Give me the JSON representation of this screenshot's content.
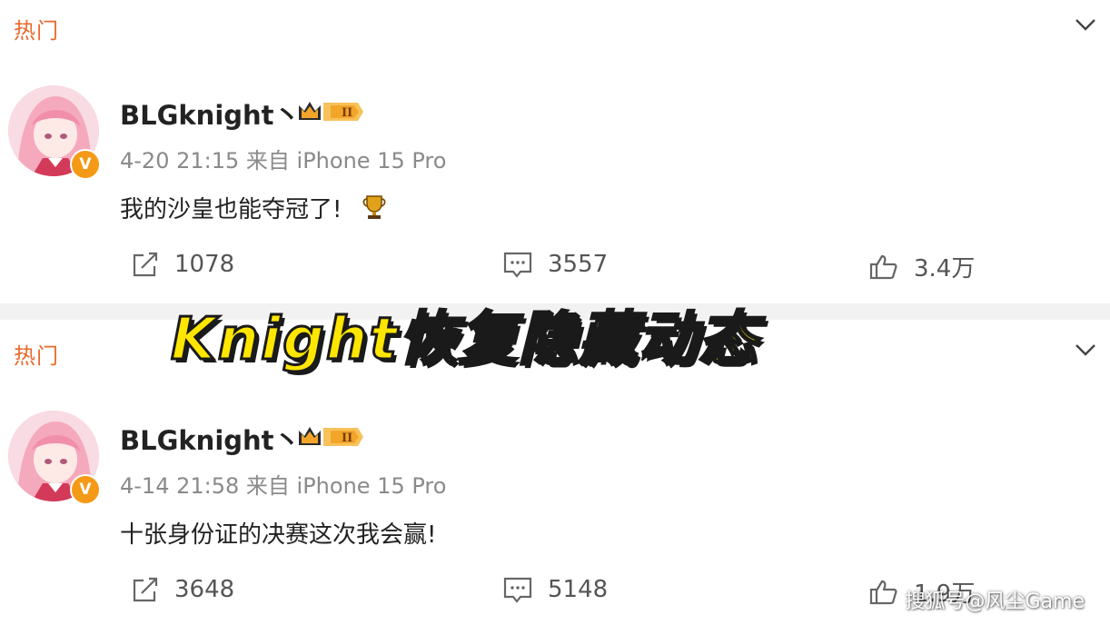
{
  "feed": {
    "posts": [
      {
        "section_label": "热门",
        "username": "BLGknight丶",
        "timestamp": "4-20 21:15",
        "source": "来自 iPhone 15 Pro",
        "content": "我的沙皇也能夺冠了!",
        "emoji": "trophy-icon",
        "reposts": "1078",
        "comments": "3557",
        "likes": "3.4万"
      },
      {
        "section_label": "热门",
        "username": "BLGknight丶",
        "timestamp": "4-14 21:58",
        "source": "来自 iPhone 15 Pro",
        "content": "十张身份证的决赛这次我会赢!",
        "reposts": "3648",
        "comments": "5148",
        "likes": "1.9万"
      }
    ]
  },
  "overlay": {
    "title": "Knight恢复隐藏动态",
    "watermark": "搜狐号@风尘Game"
  },
  "colors": {
    "hot_label": "#e86a2c",
    "overlay_fill": "#ffe600",
    "verified_badge": "#f49a16"
  }
}
